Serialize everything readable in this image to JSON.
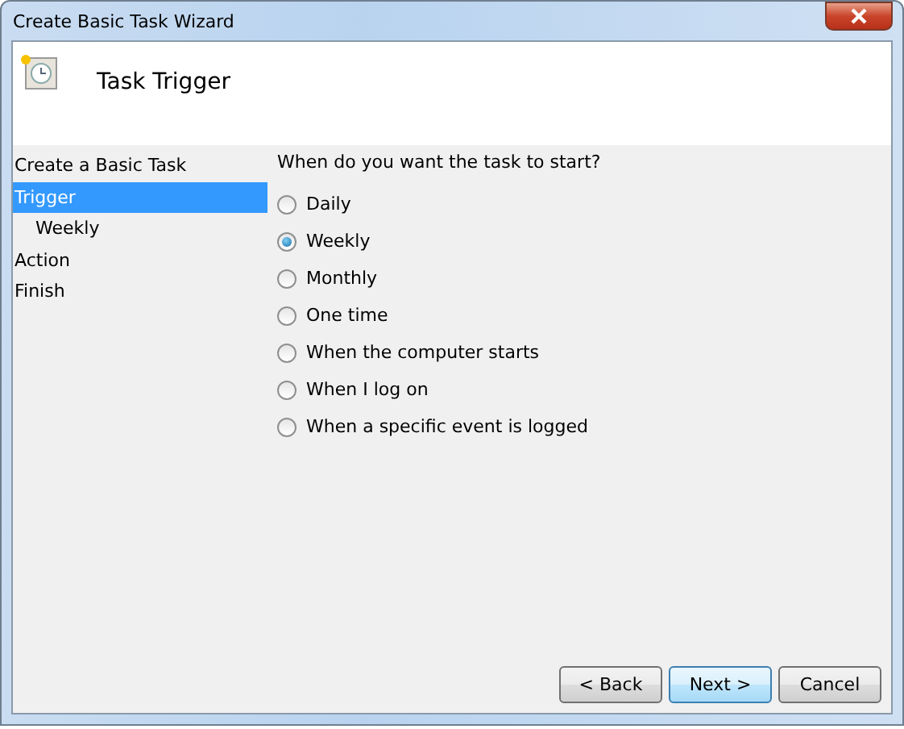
{
  "window": {
    "title": "Create Basic Task Wizard"
  },
  "header": {
    "title": "Task Trigger"
  },
  "sidebar": {
    "items": [
      {
        "label": "Create a Basic Task",
        "selected": false
      },
      {
        "label": "Trigger",
        "selected": true,
        "children": [
          {
            "label": "Weekly",
            "selected": false
          }
        ]
      },
      {
        "label": "Action",
        "selected": false
      },
      {
        "label": "Finish",
        "selected": false
      }
    ]
  },
  "question": "When do you want the task to start?",
  "options": [
    {
      "label": "Daily",
      "selected": false
    },
    {
      "label": "Weekly",
      "selected": true
    },
    {
      "label": "Monthly",
      "selected": false
    },
    {
      "label": "One time",
      "selected": false
    },
    {
      "label": "When the computer starts",
      "selected": false
    },
    {
      "label": "When I log on",
      "selected": false
    },
    {
      "label": "When a specific event is logged",
      "selected": false
    }
  ],
  "buttons": [
    {
      "label": "< Back",
      "hover": false
    },
    {
      "label": "Next >",
      "hover": true
    },
    {
      "label": "Cancel",
      "hover": false
    }
  ]
}
